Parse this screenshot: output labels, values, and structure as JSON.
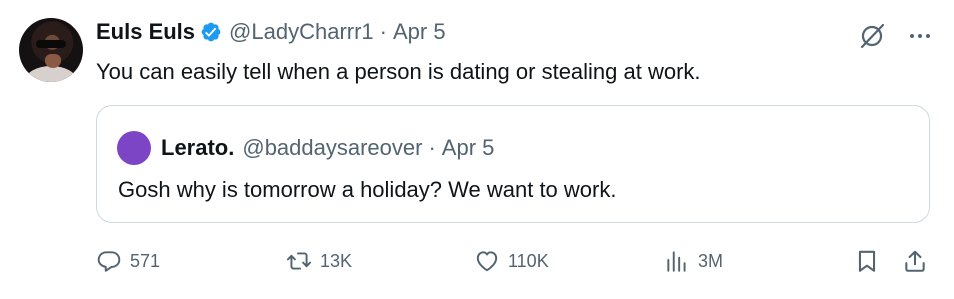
{
  "author": {
    "display_name": "Euls Euls",
    "handle": "@LadyCharrr1",
    "separator": "·",
    "date": "Apr 5"
  },
  "tweet": {
    "text": "You can easily tell when a person is dating or stealing at work."
  },
  "quoted": {
    "display_name": "Lerato.",
    "handle": "@baddaysareover",
    "separator": "·",
    "date": "Apr 5",
    "text": "Gosh why is tomorrow a holiday? We want to work.",
    "avatar_color": "#7b45c6"
  },
  "actions": {
    "replies": "571",
    "reposts": "13K",
    "likes": "110K",
    "views": "3M"
  },
  "icons": {
    "verified": "verified-badge-icon",
    "grok": "grok-icon",
    "more": "more-icon",
    "reply": "reply-icon",
    "repost": "repost-icon",
    "like": "heart-icon",
    "views": "views-icon",
    "bookmark": "bookmark-icon",
    "share": "share-icon"
  },
  "colors": {
    "text": "#0f1419",
    "secondary": "#536471",
    "verified": "#1d9bf0",
    "border": "#cfd9de"
  }
}
